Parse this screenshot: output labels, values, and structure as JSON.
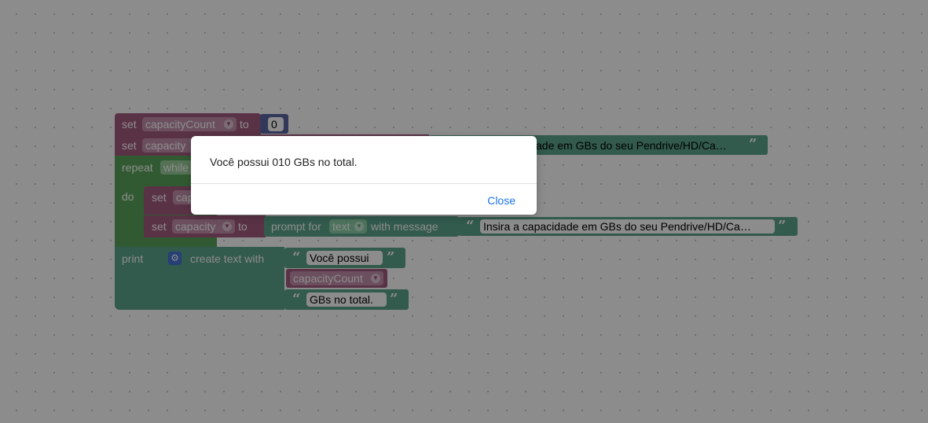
{
  "workspace": {
    "set1": {
      "keyword": "set",
      "variable": "capacityCount",
      "to": "to",
      "value": "0"
    },
    "set2": {
      "keyword": "set",
      "variable": "capacity",
      "message_tail": "ade em GBs do seu Pendrive/HD/Ca…"
    },
    "repeat": {
      "keyword": "repeat",
      "mode": "while",
      "do": "do"
    },
    "inner_set1": {
      "keyword": "set",
      "variable": "cap"
    },
    "inner_set2": {
      "keyword": "set",
      "variable": "capacity",
      "to": "to",
      "prompt": "prompt for",
      "type": "text",
      "with_message": "with message",
      "message": "Insira a capacidade em GBs do seu Pendrive/HD/Ca…"
    },
    "print": {
      "keyword": "print",
      "create_text": "create text with",
      "item1": "Você possui",
      "item2": "capacityCount",
      "item3": "GBs no total."
    }
  },
  "quotes": {
    "open": "“",
    "close": "”"
  },
  "dropdown_arrow": "▼",
  "dialog": {
    "message": "Você possui 010 GBs no total.",
    "close_label": "Close"
  },
  "colors": {
    "variables_block": "#a55b80",
    "loop_block": "#5ba55b",
    "text_block": "#5ba58c",
    "math_block": "#5b67a5",
    "dialog_button": "#1a73e8"
  }
}
